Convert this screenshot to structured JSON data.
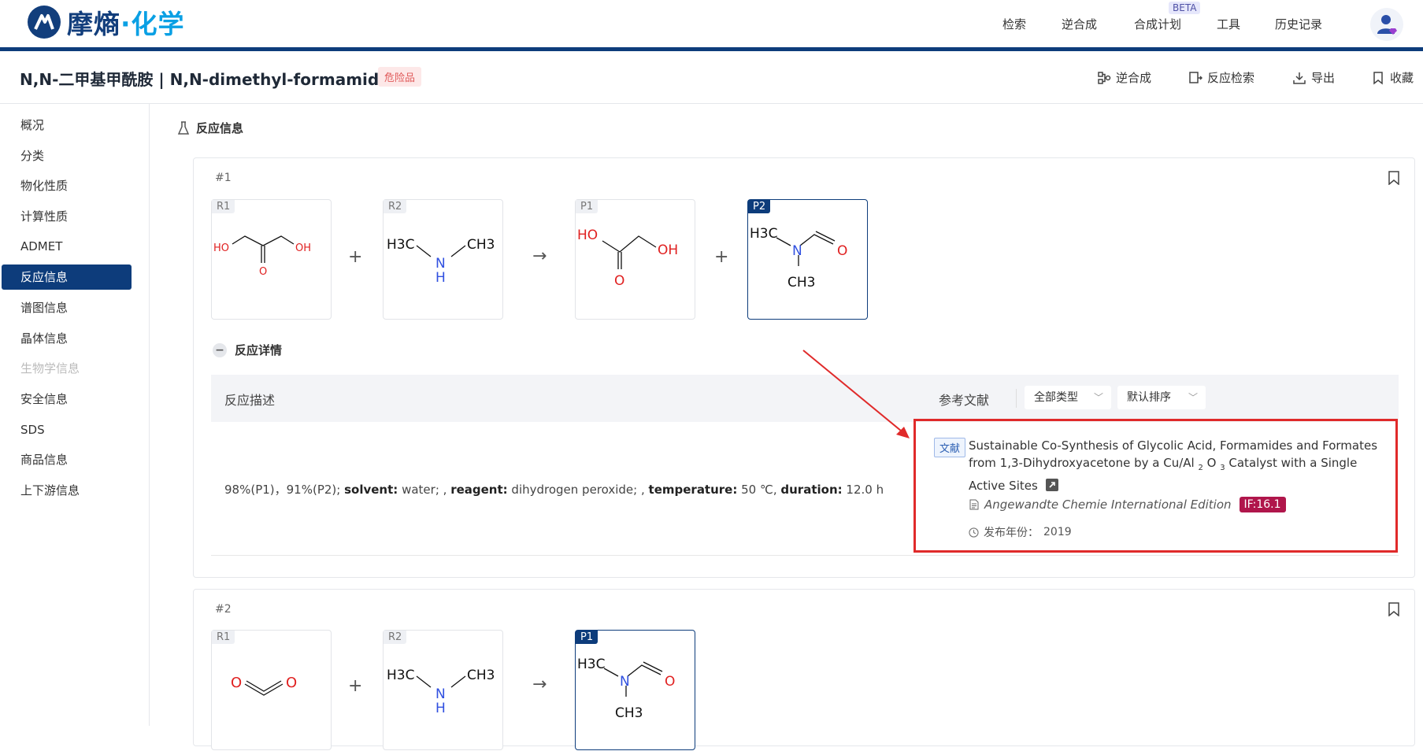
{
  "app": {
    "logo_main": "摩熵",
    "logo_accent": "·化学",
    "nav": [
      {
        "label": "检索"
      },
      {
        "label": "逆合成"
      },
      {
        "label": "合成计划",
        "badge": "BETA"
      },
      {
        "label": "工具"
      },
      {
        "label": "历史记录"
      }
    ]
  },
  "header": {
    "title": "N,N-二甲基甲酰胺 | N,N-dimethyl-formamide",
    "tag": "危险品",
    "actions": [
      {
        "label": "逆合成",
        "icon": "retrosynthesis-icon"
      },
      {
        "label": "反应检索",
        "icon": "reaction-search-icon"
      },
      {
        "label": "导出",
        "icon": "download-icon"
      },
      {
        "label": "收藏",
        "icon": "bookmark-icon"
      }
    ]
  },
  "sidebar": {
    "items": [
      {
        "label": "概况"
      },
      {
        "label": "分类"
      },
      {
        "label": "物化性质"
      },
      {
        "label": "计算性质"
      },
      {
        "label": "ADMET"
      },
      {
        "label": "反应信息",
        "active": true
      },
      {
        "label": "谱图信息"
      },
      {
        "label": "晶体信息"
      },
      {
        "label": "生物学信息",
        "disabled": true
      },
      {
        "label": "安全信息"
      },
      {
        "label": "SDS"
      },
      {
        "label": "商品信息"
      },
      {
        "label": "上下游信息"
      }
    ]
  },
  "main": {
    "section_title": "反应信息",
    "reactions": [
      {
        "num": "#1",
        "molecules": [
          {
            "tag": "R1",
            "atoms": [
              "HO",
              "O",
              "OH"
            ]
          },
          {
            "tag": "R2",
            "atoms": [
              "H3C",
              "N",
              "H",
              "CH3"
            ]
          },
          {
            "tag": "P1",
            "atoms": [
              "HO",
              "O",
              "OH"
            ]
          },
          {
            "tag": "P2",
            "atoms": [
              "H3C",
              "N",
              "O",
              "CH3"
            ],
            "selected": true
          }
        ],
        "plus": "+",
        "arrow": "→",
        "detail_label": "反应详情",
        "table": {
          "col_desc": "反应描述",
          "col_ref": "参考文献",
          "filter_type": "全部类型",
          "filter_sort": "默认排序"
        },
        "description": {
          "yields": "98%(P1)，91%(P2);",
          "solvent_label": "solvent:",
          "solvent": "water; ,",
          "reagent_label": "reagent:",
          "reagent": "dihydrogen peroxide; ,",
          "temperature_label": "temperature:",
          "temperature": "50 ℃,",
          "duration_label": "duration:",
          "duration": "12.0 h"
        },
        "reference": {
          "tag": "文献",
          "title_part1": "Sustainable Co-Synthesis of Glycolic Acid, Formamides and Formates from 1,3-Dihydroxyacetone by a Cu/Al",
          "sub1": "2",
          "title_part2": "O",
          "sub2": "3",
          "title_part3": "Catalyst with a Single Active Sites",
          "journal": "Angewandte Chemie International Edition",
          "impact_factor": "IF:16.1",
          "year_label": "发布年份：",
          "year": "2019"
        }
      },
      {
        "num": "#2",
        "molecules": [
          {
            "tag": "R1",
            "atoms": [
              "O",
              "O"
            ]
          },
          {
            "tag": "R2",
            "atoms": [
              "H3C",
              "N",
              "H",
              "CH3"
            ]
          },
          {
            "tag": "P1",
            "atoms": [
              "H3C",
              "N",
              "O",
              "CH3"
            ],
            "selected": true
          }
        ],
        "plus": "+",
        "arrow": "→"
      }
    ]
  },
  "colors": {
    "brand": "#0d3c7b",
    "accent": "#0aa0e4",
    "highlight_box": "#e02a2a",
    "if_badge": "#b0164b",
    "oxygen": "#e02020",
    "nitrogen": "#3050e0"
  }
}
